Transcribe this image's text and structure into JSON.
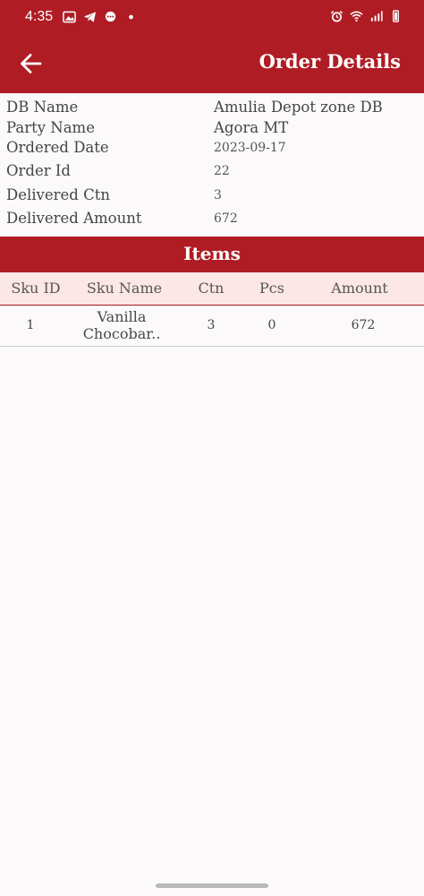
{
  "status_bar": {
    "time": "4:35",
    "left_icons": [
      "gallery-icon",
      "telegram-icon",
      "chat-icon",
      "dot-icon"
    ],
    "right_icons": [
      "alarm-icon",
      "wifi-icon",
      "signal-icon",
      "battery-icon"
    ]
  },
  "app_bar": {
    "title": "Order Details",
    "back_icon": "arrow-left-icon"
  },
  "order": {
    "fields": [
      {
        "label": "DB Name",
        "value": "Amulia Depot zone DB"
      },
      {
        "label": "Party Name",
        "value": "Agora MT"
      },
      {
        "label": "Ordered Date",
        "value": "2023-09-17"
      },
      {
        "label": "Order Id",
        "value": "22"
      },
      {
        "label": "Delivered Ctn",
        "value": "3"
      },
      {
        "label": "Delivered Amount",
        "value": "672"
      }
    ]
  },
  "items": {
    "title": "Items",
    "columns": [
      "Sku ID",
      "Sku Name",
      "Ctn",
      "Pcs",
      "Amount"
    ],
    "rows": [
      {
        "sku_id": "1",
        "sku_name_line1": "Vanilla",
        "sku_name_line2": "Chocobar..",
        "ctn": "3",
        "pcs": "0",
        "amount": "672"
      }
    ]
  },
  "colors": {
    "primary": "#b01c24",
    "table_header_bg": "#fde7e6",
    "background": "#fbf9fa"
  }
}
